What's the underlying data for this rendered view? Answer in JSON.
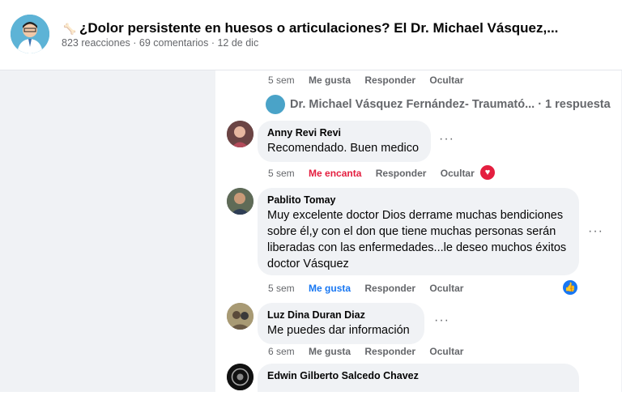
{
  "post": {
    "title": "¿Dolor persistente en huesos o articulaciones? El Dr. Michael Vásquez,...",
    "meta": "823 reacciones · 69 comentarios · 12 de dic"
  },
  "top_actions": {
    "time": "5 sem",
    "like": "Me gusta",
    "reply": "Responder",
    "hide": "Ocultar"
  },
  "reply_thread": {
    "author": "Dr. Michael Vásquez Fernández- Traumató...",
    "count": "· 1 respuesta"
  },
  "comments": [
    {
      "author": "Anny Revi Revi",
      "text": "Recomendado. Buen medico",
      "time": "5 sem",
      "like": "Me encanta",
      "reply": "Responder",
      "hide": "Ocultar",
      "reaction": "love"
    },
    {
      "author": "Pablito Tomay",
      "text": "Muy excelente doctor Dios derrame muchas bendiciones sobre él,y con el don que tiene muchas personas serán liberadas con las enfermedades...le deseo muchos éxitos doctor Vásquez",
      "time": "5 sem",
      "like": "Me gusta",
      "reply": "Responder",
      "hide": "Ocultar",
      "reaction": "like"
    },
    {
      "author": "Luz Dina Duran Diaz",
      "text": "Me puedes dar información",
      "time": "6 sem",
      "like": "Me gusta",
      "reply": "Responder",
      "hide": "Ocultar"
    },
    {
      "author": "Edwin Gilberto Salcedo Chavez",
      "text": ""
    }
  ],
  "colors": {
    "accent": "#1877f2",
    "love": "#e41e3f",
    "bubble": "#f0f2f5",
    "muted": "#65676b"
  }
}
